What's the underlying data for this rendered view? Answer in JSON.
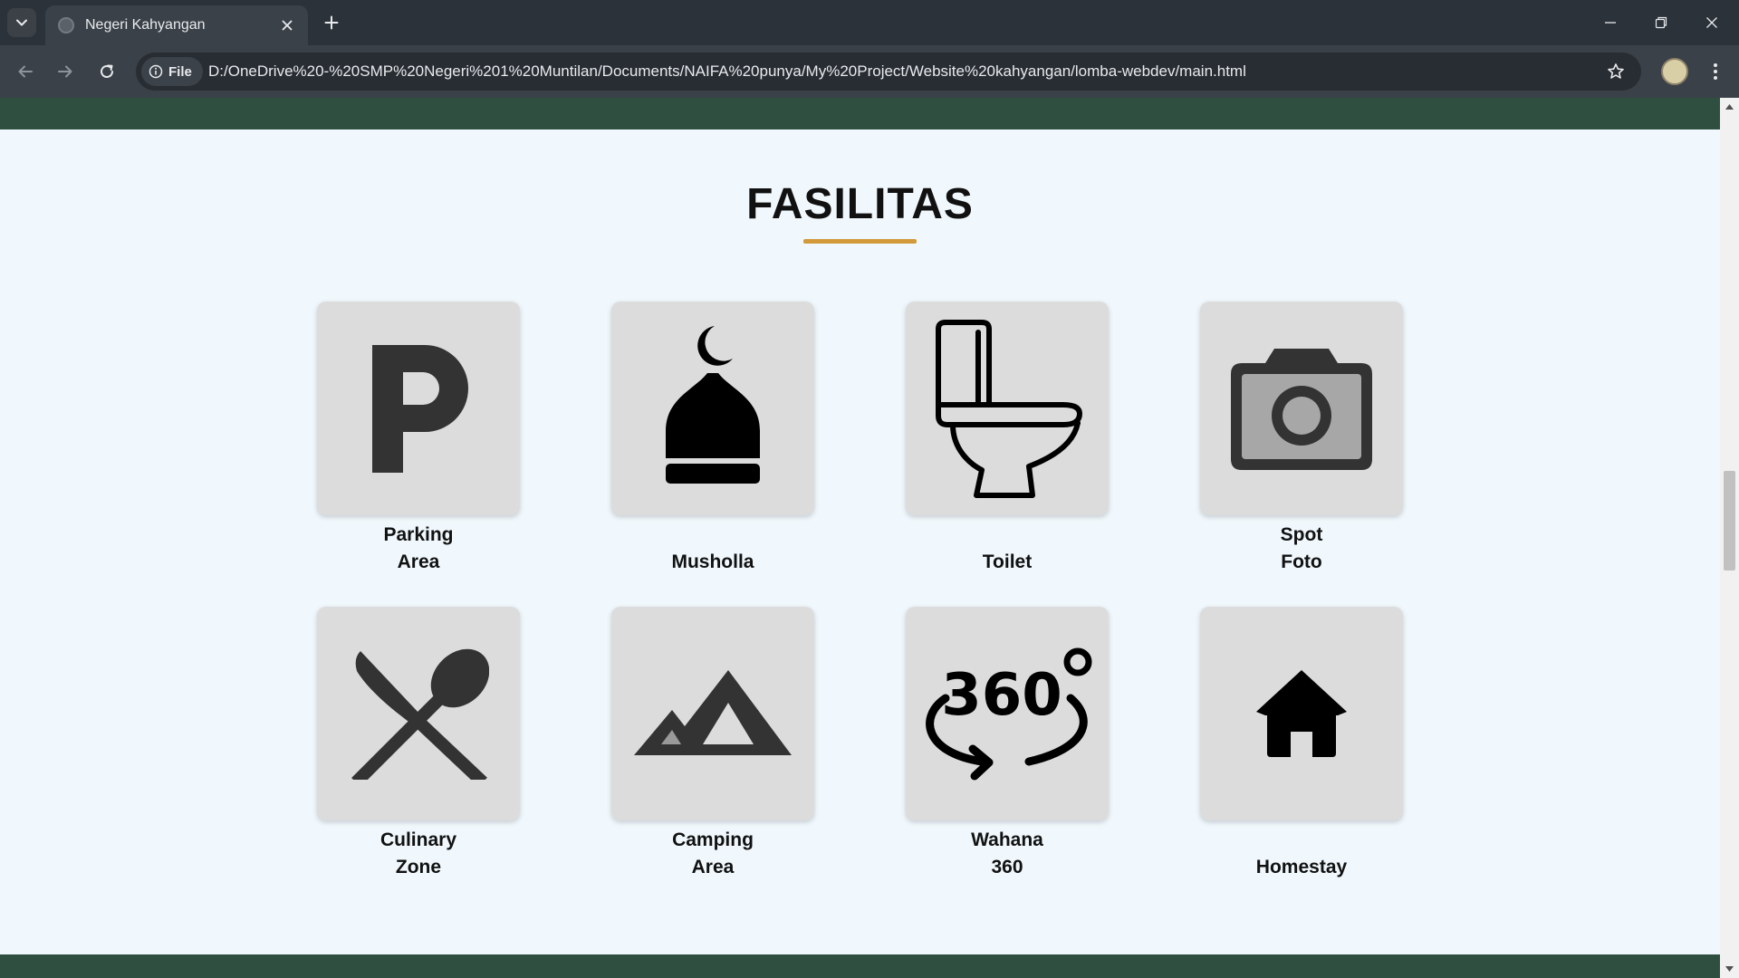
{
  "browser": {
    "tab_title": "Negeri Kahyangan",
    "chip_label": "File",
    "url": "D:/OneDrive%20-%20SMP%20Negeri%201%20Muntilan/Documents/NAIFA%20punya/My%20Project/Website%20kahyangan/lomba-webdev/main.html"
  },
  "section": {
    "title": "FASILITAS",
    "accent_color": "#d39a3b",
    "band_color": "#2f5040",
    "background_color": "#f0f8fd"
  },
  "facilities": [
    {
      "line1": "Parking",
      "line2": "Area",
      "icon": "parking-icon"
    },
    {
      "line1": "",
      "line2": "Musholla",
      "icon": "mosque-dome-icon"
    },
    {
      "line1": "",
      "line2": "Toilet",
      "icon": "toilet-icon"
    },
    {
      "line1": "Spot",
      "line2": "Foto",
      "icon": "camera-icon"
    },
    {
      "line1": "Culinary",
      "line2": "Zone",
      "icon": "spoon-knife-icon"
    },
    {
      "line1": "Camping",
      "line2": "Area",
      "icon": "mountain-icon"
    },
    {
      "line1": "Wahana",
      "line2": "360",
      "icon": "rotate-360-icon"
    },
    {
      "line1": "",
      "line2": "Homestay",
      "icon": "house-icon"
    }
  ]
}
